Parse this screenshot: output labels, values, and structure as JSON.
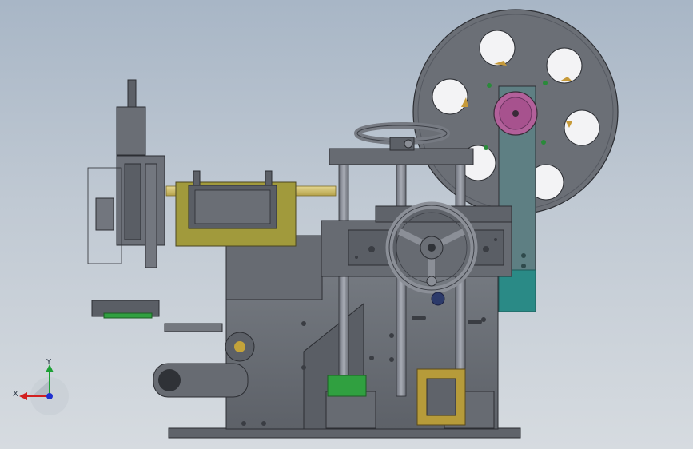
{
  "app": {
    "view": "front",
    "document_kind": "assembly"
  },
  "triad": {
    "x_label": "X",
    "y_label": "Y",
    "x_color": "#d22020",
    "y_color": "#1ca035",
    "z_color": "#2030d0"
  },
  "colors": {
    "background_top": "#a8b6c6",
    "background_bottom": "#d6dbe0",
    "steel": "#6c7178",
    "steel_dark": "#4a4e55",
    "steel_light": "#8a8f96",
    "brass": "#c8b45a",
    "olive": "#a19a3c",
    "teal": "#2a8a86",
    "magenta": "#b2609a",
    "green": "#30a040"
  }
}
